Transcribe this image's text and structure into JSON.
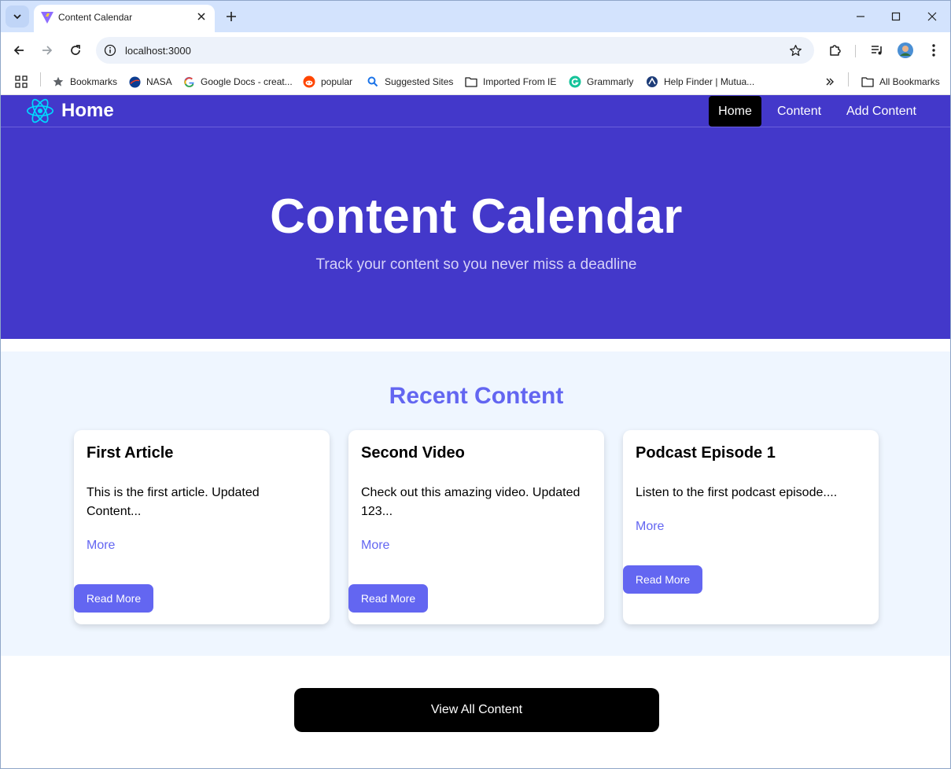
{
  "browser": {
    "tab_title": "Content Calendar",
    "url": "localhost:3000",
    "bookmarks": [
      {
        "label": "Bookmarks",
        "icon": "star-icon"
      },
      {
        "label": "NASA",
        "icon": "nasa-icon"
      },
      {
        "label": "Google Docs - creat...",
        "icon": "google-icon"
      },
      {
        "label": "popular",
        "icon": "reddit-icon"
      },
      {
        "label": "Suggested Sites",
        "icon": "search-icon"
      },
      {
        "label": "Imported From IE",
        "icon": "folder-icon"
      },
      {
        "label": "Grammarly",
        "icon": "grammarly-icon"
      },
      {
        "label": "Help Finder | Mutua...",
        "icon": "help-finder-icon"
      }
    ],
    "all_bookmarks": "All Bookmarks"
  },
  "nav": {
    "brand": "Home",
    "links": [
      "Home",
      "Content",
      "Add Content"
    ],
    "active": "Home"
  },
  "hero": {
    "title": "Content Calendar",
    "subtitle": "Track your content so you never miss a deadline"
  },
  "recent": {
    "heading": "Recent Content",
    "cards": [
      {
        "title": "First Article",
        "description": "This is the first article. Updated Content...",
        "more": "More",
        "button": "Read More"
      },
      {
        "title": "Second Video",
        "description": "Check out this amazing video. Updated 123...",
        "more": "More",
        "button": "Read More"
      },
      {
        "title": "Podcast Episode 1",
        "description": "Listen to the first podcast episode....",
        "more": "More",
        "button": "Read More"
      }
    ]
  },
  "view_all": "View All Content",
  "colors": {
    "primary": "#4338ca",
    "accent": "#6366f1",
    "section_bg": "#eff6ff",
    "react_logo": "#00d8ff"
  }
}
